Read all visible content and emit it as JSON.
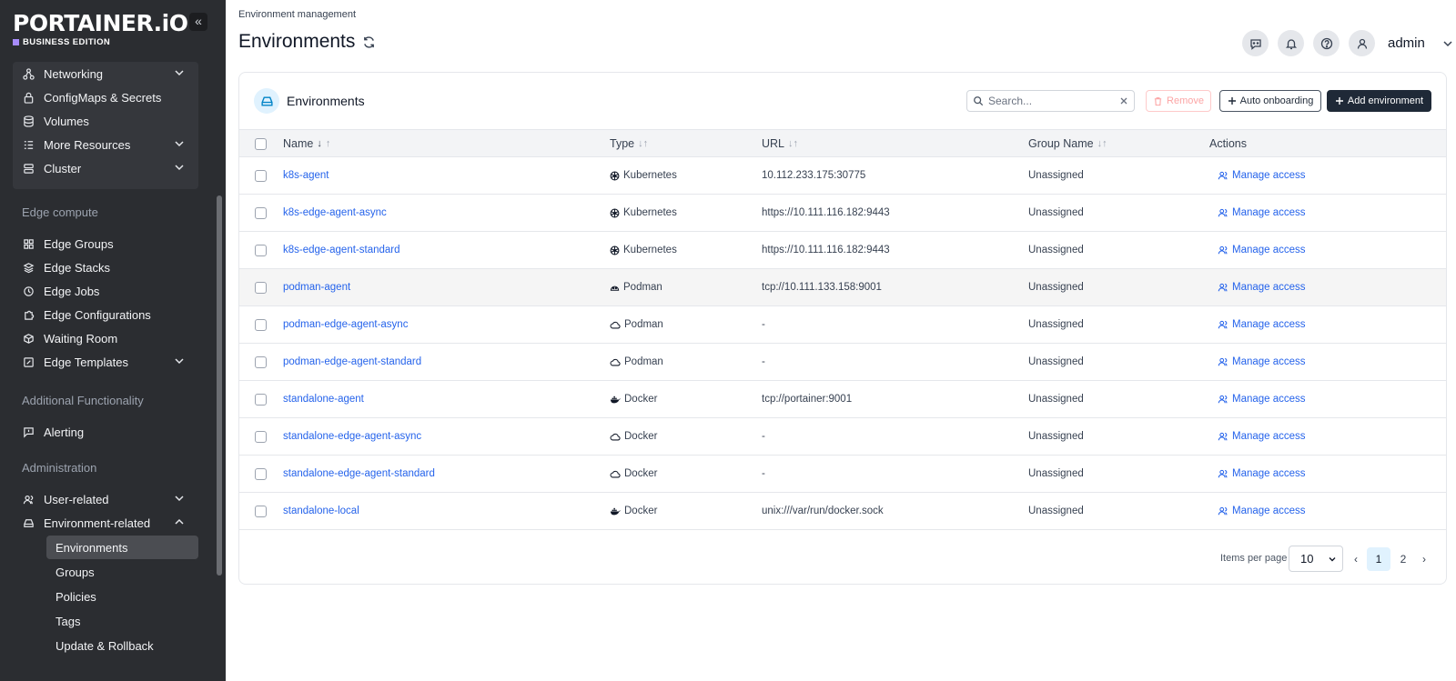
{
  "sidebar": {
    "logo_main": "PORTAINER.iO",
    "logo_sub": "BUSINESS EDITION",
    "collapse_glyph": "«",
    "top_items": [
      {
        "label": "Networking",
        "icon": "network-icon",
        "chevron": true
      },
      {
        "label": "ConfigMaps & Secrets",
        "icon": "lock-icon",
        "chevron": false
      },
      {
        "label": "Volumes",
        "icon": "database-icon",
        "chevron": false
      },
      {
        "label": "More Resources",
        "icon": "list-icon",
        "chevron": true
      },
      {
        "label": "Cluster",
        "icon": "server-icon",
        "chevron": true
      }
    ],
    "section_edge": "Edge compute",
    "edge_items": [
      {
        "label": "Edge Groups",
        "icon": "grid-icon"
      },
      {
        "label": "Edge Stacks",
        "icon": "layers-icon"
      },
      {
        "label": "Edge Jobs",
        "icon": "clock-icon"
      },
      {
        "label": "Edge Configurations",
        "icon": "puzzle-icon"
      },
      {
        "label": "Waiting Room",
        "icon": "box-icon"
      },
      {
        "label": "Edge Templates",
        "icon": "edit-icon"
      }
    ],
    "section_additional": "Additional Functionality",
    "alerting": "Alerting",
    "section_admin": "Administration",
    "user_related": "User-related",
    "environment_related": "Environment-related",
    "env_sub": [
      "Environments",
      "Groups",
      "Policies",
      "Tags",
      "Update & Rollback"
    ]
  },
  "header": {
    "breadcrumb": "Environment management",
    "title": "Environments",
    "user": "admin"
  },
  "card": {
    "title": "Environments",
    "search_placeholder": "Search...",
    "remove_label": "Remove",
    "auto_label": "Auto onboarding",
    "add_label": "Add environment"
  },
  "table": {
    "columns": {
      "name": "Name",
      "type": "Type",
      "url": "URL",
      "group": "Group Name",
      "actions": "Actions"
    },
    "action_label": "Manage access",
    "rows": [
      {
        "name": "k8s-agent",
        "type": "Kubernetes",
        "type_icon": "kubernetes-icon",
        "url": "10.112.233.175:30775",
        "group": "Unassigned"
      },
      {
        "name": "k8s-edge-agent-async",
        "type": "Kubernetes",
        "type_icon": "kubernetes-icon",
        "url": "https://10.111.116.182:9443",
        "group": "Unassigned"
      },
      {
        "name": "k8s-edge-agent-standard",
        "type": "Kubernetes",
        "type_icon": "kubernetes-icon",
        "url": "https://10.111.116.182:9443",
        "group": "Unassigned"
      },
      {
        "name": "podman-agent",
        "type": "Podman",
        "type_icon": "podman-icon",
        "url": "tcp://10.111.133.158:9001",
        "group": "Unassigned"
      },
      {
        "name": "podman-edge-agent-async",
        "type": "Podman",
        "type_icon": "cloud-icon",
        "url": "-",
        "group": "Unassigned"
      },
      {
        "name": "podman-edge-agent-standard",
        "type": "Podman",
        "type_icon": "cloud-icon",
        "url": "-",
        "group": "Unassigned"
      },
      {
        "name": "standalone-agent",
        "type": "Docker",
        "type_icon": "docker-icon",
        "url": "tcp://portainer:9001",
        "group": "Unassigned"
      },
      {
        "name": "standalone-edge-agent-async",
        "type": "Docker",
        "type_icon": "cloud-icon",
        "url": "-",
        "group": "Unassigned"
      },
      {
        "name": "standalone-edge-agent-standard",
        "type": "Docker",
        "type_icon": "cloud-icon",
        "url": "-",
        "group": "Unassigned"
      },
      {
        "name": "standalone-local",
        "type": "Docker",
        "type_icon": "docker-icon",
        "url": "unix:///var/run/docker.sock",
        "group": "Unassigned"
      }
    ]
  },
  "pagination": {
    "items_per_page_label": "Items per page",
    "items_per_page": "10",
    "pages": [
      "1",
      "2"
    ],
    "current": "1",
    "prev": "‹",
    "next": "›"
  }
}
